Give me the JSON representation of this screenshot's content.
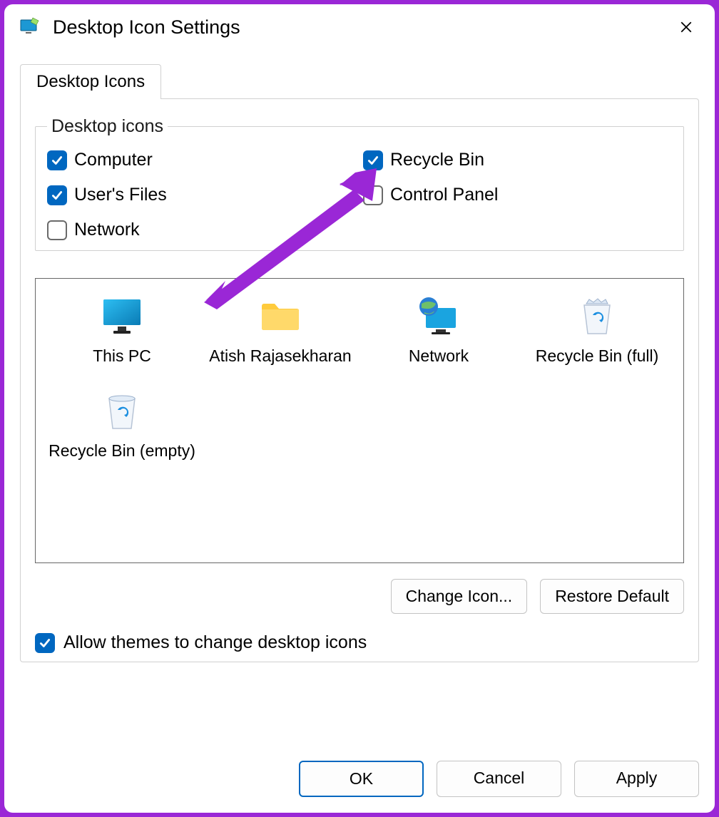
{
  "window": {
    "title": "Desktop Icon Settings"
  },
  "tabs": {
    "items": [
      {
        "label": "Desktop Icons"
      }
    ]
  },
  "group": {
    "legend": "Desktop icons",
    "checkboxes": {
      "computer": {
        "label": "Computer",
        "checked": true
      },
      "users_files": {
        "label": "User's Files",
        "checked": true
      },
      "network": {
        "label": "Network",
        "checked": false
      },
      "recycle_bin": {
        "label": "Recycle Bin",
        "checked": true
      },
      "control_panel": {
        "label": "Control Panel",
        "checked": false
      }
    }
  },
  "icons": [
    {
      "key": "this-pc",
      "label": "This PC",
      "icon": "monitor"
    },
    {
      "key": "user-folder",
      "label": "Atish Rajasekharan",
      "icon": "folder"
    },
    {
      "key": "network",
      "label": "Network",
      "icon": "network"
    },
    {
      "key": "recycle-full",
      "label": "Recycle Bin (full)",
      "icon": "bin-full"
    },
    {
      "key": "recycle-empty",
      "label": "Recycle Bin (empty)",
      "icon": "bin-empty"
    }
  ],
  "buttons": {
    "change_icon": "Change Icon...",
    "restore_default": "Restore Default",
    "ok": "OK",
    "cancel": "Cancel",
    "apply": "Apply"
  },
  "allow_themes": {
    "label": "Allow themes to change desktop icons",
    "checked": true
  },
  "annotation": {
    "type": "arrow",
    "target": "recycle-bin-checkbox",
    "color": "#9a27d6"
  }
}
